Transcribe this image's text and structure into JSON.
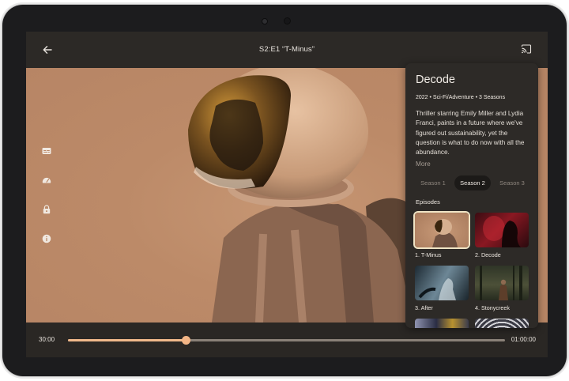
{
  "player": {
    "title": "S2:E1 “T-Minus”",
    "elapsed": "30:00",
    "total": "01:00:00",
    "progress": 0.269
  },
  "side_icons": [
    "captions-icon",
    "speed-icon",
    "lock-icon",
    "info-icon"
  ],
  "panel": {
    "title": "Decode",
    "meta": "2022 • Sci-Fi/Adventure • 3 Seasons",
    "description": "Thriller starring Emily Miller and Lydia Franci, paints in a future where we've figured out sustainability, yet the question is what to do now with all the abundance.",
    "more": "More",
    "seasons": [
      "Season 1",
      "Season 2",
      "Season 3"
    ],
    "selected_season": 1,
    "episodes_label": "Episodes",
    "episodes": [
      {
        "label": "1. T-Minus"
      },
      {
        "label": "2. Decode"
      },
      {
        "label": "3. After"
      },
      {
        "label": "4. Stonycreek"
      }
    ]
  },
  "colors": {
    "accent": "#f3b586",
    "video_tint": "#bc8a68",
    "panel_bg": "#2d2a27"
  }
}
